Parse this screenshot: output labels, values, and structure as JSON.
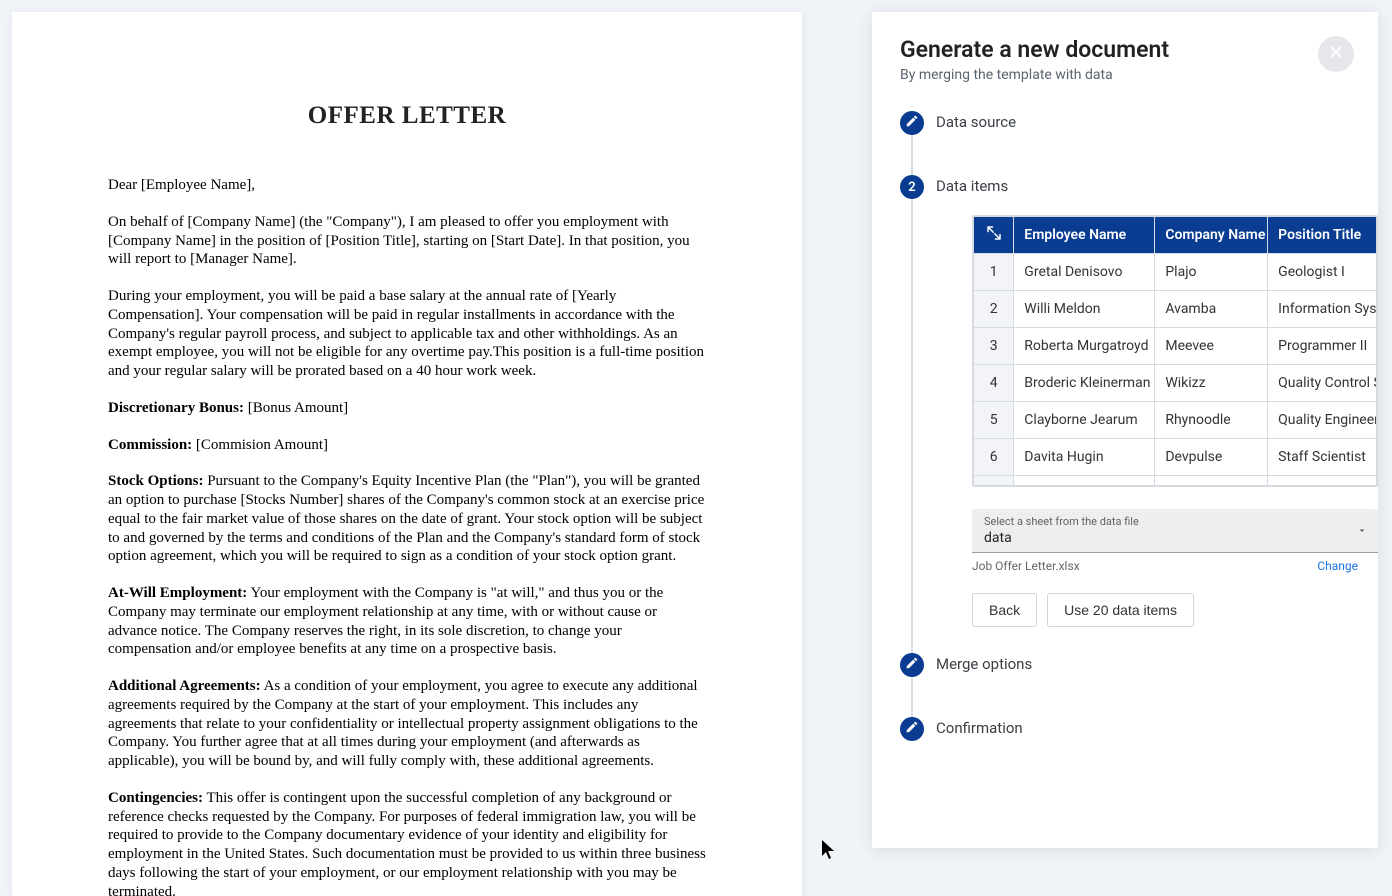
{
  "document": {
    "title": "OFFER LETTER",
    "greeting": "Dear [Employee Name],",
    "p_intro": "On behalf of [Company Name] (the \"Company\"), I am pleased to offer you employment with [Company Name] in the position of [Position Title], starting on [Start Date]. In that position, you will report to [Manager Name].",
    "p_salary": "During your employment, you will be paid a base salary at the annual rate of [Yearly Compensation]. Your compensation will be paid in regular installments in accordance with the Company's regular payroll process, and subject to applicable tax and other withholdings. As an exempt employee, you will not be eligible for any overtime pay.This position is a full-time position and your regular salary will be prorated based on a 40 hour work week.",
    "bonus_label": "Discretionary Bonus:",
    "bonus_val": " [Bonus Amount]",
    "commission_label": "Commission:",
    "commission_val": " [Commision Amount]",
    "stock_label": "Stock Options:",
    "stock_body": " Pursuant to the Company's Equity Incentive Plan (the \"Plan\"), you will be granted an option to purchase [Stocks Number] shares of the Company's common stock at an exercise price equal to the fair market value of those shares on the date of grant. Your stock option will be subject to and governed by the terms and conditions of the Plan and the Company's standard form of stock option agreement, which you will be required to sign as a condition of your stock option grant.",
    "atwill_label": "At-Will Employment:",
    "atwill_body": " Your employment with the Company is \"at will,\" and thus you or the Company may terminate our employment relationship at any time, with or without cause or advance notice. The Company reserves the right, in its sole discretion, to change your compensation and/or employee benefits at any time on a prospective basis.",
    "add_label": "Additional Agreements:",
    "add_body": " As a condition of your employment, you agree to execute any additional agreements required by the Company at the start of your employment. This includes any agreements that relate to your confidentiality or intellectual property assignment obligations to the Company. You further agree that at all times during your employment (and afterwards as applicable), you will be bound by, and will fully comply with, these additional agreements.",
    "cont_label": "Contingencies:",
    "cont_body": " This offer is contingent upon the successful completion of any background or reference checks requested by the Company. For purposes of federal immigration law, you will be required to provide to the Company documentary evidence of your identity and eligibility for employment in the United States. Such documentation must be provided to us within three business days following the start of your employment, or our employment relationship with you may be terminated."
  },
  "panel": {
    "title": "Generate a new document",
    "subtitle": "By merging the template with data",
    "steps": {
      "s1": "Data source",
      "s2_num": "2",
      "s2": "Data items",
      "s3": "Merge options",
      "s4": "Confirmation"
    },
    "table": {
      "headers": {
        "emp": "Employee Name",
        "comp": "Company Name",
        "pos": "Position Title"
      },
      "rows": [
        {
          "n": "1",
          "emp": "Gretal Denisovo",
          "comp": "Plajo",
          "pos": "Geologist I"
        },
        {
          "n": "2",
          "emp": "Willi Meldon",
          "comp": "Avamba",
          "pos": "Information Sys"
        },
        {
          "n": "3",
          "emp": "Roberta Murgatroyd",
          "comp": "Meevee",
          "pos": "Programmer II"
        },
        {
          "n": "4",
          "emp": "Broderic Kleinerman",
          "comp": "Wikizz",
          "pos": "Quality Control S"
        },
        {
          "n": "5",
          "emp": "Clayborne Jearum",
          "comp": "Rhynoodle",
          "pos": "Quality Engineer"
        },
        {
          "n": "6",
          "emp": "Davita Hugin",
          "comp": "Devpulse",
          "pos": "Staff Scientist"
        }
      ]
    },
    "sheet": {
      "label": "Select a sheet from the data file",
      "value": "data"
    },
    "file": {
      "name": "Job Offer Letter.xlsx",
      "change": "Change"
    },
    "buttons": {
      "back": "Back",
      "use": "Use 20 data items"
    }
  }
}
